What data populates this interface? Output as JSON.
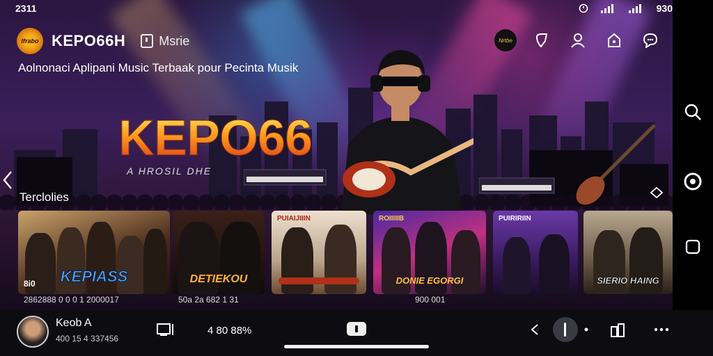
{
  "status_bar": {
    "time": "2311",
    "battery_text": "930"
  },
  "app": {
    "name": "KEPO66H",
    "section_label": "Msrie",
    "logo_text": "Ifrabo",
    "tagline": "Aolnonaci Aplipani Music Terbaak pour Pecinta Musik"
  },
  "hero": {
    "brand_text": "KEPO66",
    "brand_subtitle": "A HROSIL DHE"
  },
  "top_icons": [
    "album-badge-icon",
    "bookmark-icon",
    "user-icon",
    "bag-icon",
    "chat-icon"
  ],
  "top_album_badge_text": "Nrtbe",
  "side_rail": [
    "search-icon",
    "record-icon",
    "stop-icon"
  ],
  "row": {
    "title": "Terclolies",
    "cards": [
      {
        "title": "KEPIASS",
        "top": ""
      },
      {
        "title": "DETIEKOU",
        "top": ""
      },
      {
        "title": "",
        "top": "PUIAIJIIIN"
      },
      {
        "title": "DONIE EGORGI",
        "top": "ROIIIIIB"
      },
      {
        "title": "",
        "top": "PUIRIRIIN"
      },
      {
        "title": "SIERIO HAING",
        "top": ""
      }
    ],
    "card_badge_1": "8i0",
    "meta": [
      "2862888 0 0 0 1 2000017",
      "50a 2a 682 1 31",
      "900 001"
    ]
  },
  "now_playing": {
    "title": "Keob A",
    "subtitle": "400 15 4 337456"
  },
  "player": {
    "volume_text": "4 80 88%"
  },
  "colors": {
    "accent_orange": "#ff9a1e",
    "bar_bg": "#0d0c10",
    "rail_bg": "#000000"
  }
}
